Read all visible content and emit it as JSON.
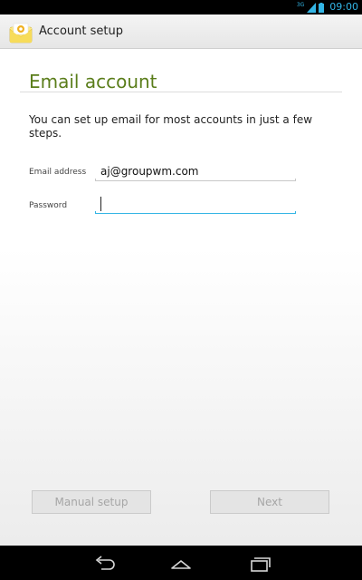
{
  "status_bar": {
    "network": "3G",
    "time": "09:00",
    "icons": [
      "signal-icon",
      "battery-icon"
    ]
  },
  "action_bar": {
    "app_icon": "email-app-icon",
    "title": "Account setup"
  },
  "main": {
    "section_title": "Email account",
    "intro": "You can set up email for most accounts in just a few steps.",
    "email": {
      "label": "Email address",
      "value": "aj@groupwm.com"
    },
    "password": {
      "label": "Password",
      "value": ""
    },
    "buttons": {
      "manual_setup": "Manual setup",
      "next": "Next"
    }
  },
  "nav_bar": {
    "icons": [
      "back-icon",
      "home-icon",
      "recent-apps-icon"
    ]
  },
  "colors": {
    "accent": "#33b5e5",
    "title_green": "#5a7d1a"
  }
}
